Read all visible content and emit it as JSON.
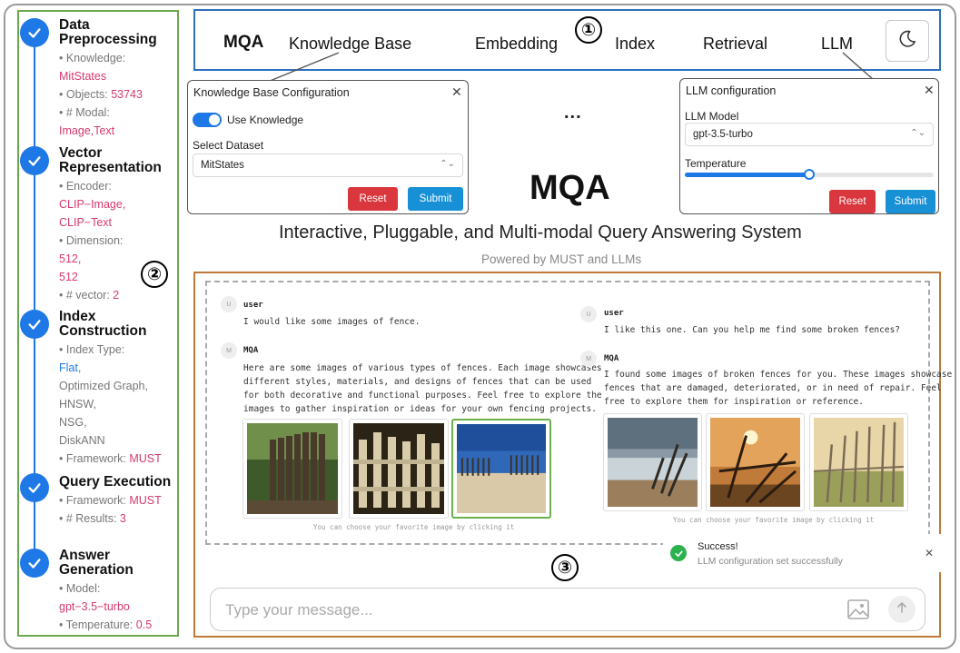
{
  "sidebar": {
    "steps": [
      {
        "title": "Data Preprocessing",
        "lines": [
          {
            "label": "• Knowledge:",
            "value": "MitStates"
          },
          {
            "label": "• Objects:",
            "value": "53743"
          },
          {
            "label": "• # Modal:",
            "value": "Image,Text"
          }
        ]
      },
      {
        "title": "Vector Representation",
        "lines": [
          {
            "label": "• Encoder:",
            "value": "CLIP−Image, CLIP−Text"
          },
          {
            "label": "• Dimension:",
            "value": "512, 512"
          },
          {
            "label": "• # vector:",
            "value": "2"
          }
        ]
      },
      {
        "title": "Index Construction",
        "index_type_label": "• Index Type:",
        "index_types": [
          "Flat",
          "Optimized Graph,",
          "HNSW,",
          "NSG,",
          "DiskANN"
        ],
        "framework_label": "• Framework:",
        "framework": "MUST"
      },
      {
        "title": "Query Execution",
        "lines": [
          {
            "label": "• Framework:",
            "value": "MUST"
          },
          {
            "label": "• # Results:",
            "value": "3"
          }
        ]
      },
      {
        "title": "Answer Generation",
        "lines": [
          {
            "label": "• Model:",
            "value": "gpt−3.5−turbo"
          },
          {
            "label": "• Temperature:",
            "value": "0.5"
          }
        ]
      }
    ]
  },
  "markers": {
    "one": "①",
    "two": "②",
    "three": "③"
  },
  "navbar": {
    "brand": "MQA",
    "items": [
      "Knowledge Base",
      "Embedding",
      "Index",
      "Retrieval",
      "LLM"
    ],
    "theme_icon": "moon-icon"
  },
  "kb_panel": {
    "title": "Knowledge Base Configuration",
    "toggle_label": "Use Knowledge",
    "toggle_on": true,
    "dataset_label": "Select Dataset",
    "dataset_value": "MitStates",
    "reset": "Reset",
    "submit": "Submit"
  },
  "llm_panel": {
    "title": "LLM configuration",
    "model_label": "LLM Model",
    "model_value": "gpt-3.5-turbo",
    "temperature_label": "Temperature",
    "temperature_fraction": 0.5,
    "reset": "Reset",
    "submit": "Submit"
  },
  "ellipsis": "...",
  "hero": {
    "title": "MQA",
    "subtitle": "Interactive, Pluggable, and Multi-modal Query Answering System",
    "powered": "Powered by MUST and LLMs"
  },
  "chat": {
    "left": {
      "user_avatar": "U",
      "user_name": "user",
      "user_msg": "I would like some images of fence.",
      "bot_avatar": "M",
      "bot_name": "MQA",
      "bot_lines": [
        "Here are some images of various types of fences. Each image showcases",
        "different styles, materials, and designs of fences that can be used",
        "for both decorative and functional purposes. Feel free to explore the",
        "images to gather inspiration or ideas for your own fencing projects."
      ],
      "hint": "You can choose your favorite image by clicking it"
    },
    "right": {
      "user_avatar": "U",
      "user_name": "user",
      "user_msg": "I like this one. Can you help me find some broken fences?",
      "bot_avatar": "M",
      "bot_name": "MQA",
      "bot_lines": [
        "I found some images of broken fences for you. These images showcase",
        "fences that are damaged, deteriorated, or in need of repair. Feel",
        "free to explore them for inspiration or reference."
      ],
      "hint": "You can choose your favorite image by clicking it"
    }
  },
  "toast": {
    "title": "Success!",
    "message": "LLM configuration set successfully"
  },
  "input": {
    "placeholder": "Type your message..."
  }
}
